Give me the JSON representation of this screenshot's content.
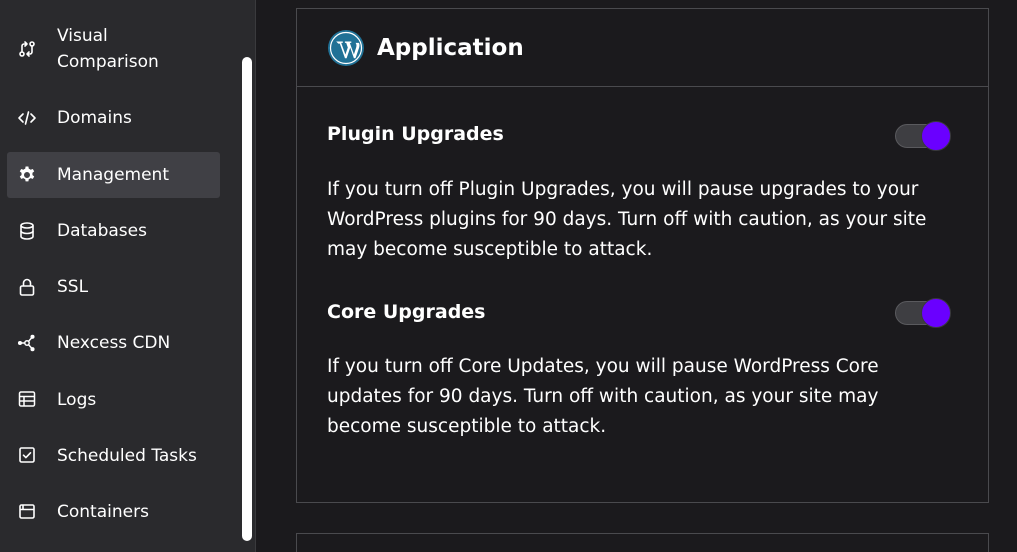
{
  "sidebar": {
    "items": [
      {
        "label": "Visual Comparison",
        "icon": "visual-comparison-icon",
        "active": false
      },
      {
        "label": "Domains",
        "icon": "code-icon",
        "active": false
      },
      {
        "label": "Management",
        "icon": "gear-icon",
        "active": true
      },
      {
        "label": "Databases",
        "icon": "database-icon",
        "active": false
      },
      {
        "label": "SSL",
        "icon": "lock-icon",
        "active": false
      },
      {
        "label": "Nexcess CDN",
        "icon": "cdn-network-icon",
        "active": false
      },
      {
        "label": "Logs",
        "icon": "logs-table-icon",
        "active": false
      },
      {
        "label": "Scheduled Tasks",
        "icon": "calendar-check-icon",
        "active": false
      },
      {
        "label": "Containers",
        "icon": "container-icon",
        "active": false
      }
    ]
  },
  "panel": {
    "title": "Application",
    "icon": "wordpress-icon",
    "settings": [
      {
        "title": "Plugin Upgrades",
        "description": "If you turn off Plugin Upgrades, you will pause upgrades to your WordPress plugins for 90 days. Turn off with caution, as your site may become susceptible to attack.",
        "enabled": true
      },
      {
        "title": "Core Upgrades",
        "description": "If you turn off Core Updates, you will pause WordPress Core updates for 90 days. Turn off with caution, as your site may become susceptible to attack.",
        "enabled": true
      }
    ]
  },
  "colors": {
    "toggle_on": "#6a00ff",
    "sidebar_bg": "#2a2a2d",
    "active_bg": "#404045",
    "page_bg": "#1b1a1d",
    "wordpress_blue": "#207196"
  }
}
